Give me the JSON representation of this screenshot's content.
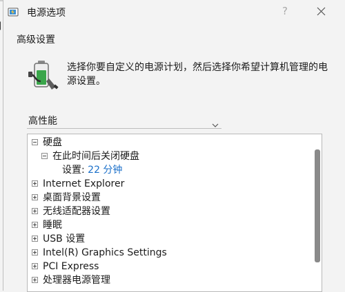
{
  "window": {
    "title": "电源选项",
    "help_label": "?"
  },
  "section_title": "高级设置",
  "description": "选择你要自定义的电源计划，然后选择你希望计算机管理的电源设置。",
  "plan": {
    "selected": "高性能"
  },
  "tree": {
    "hard_disk": "硬盘",
    "turn_off_after": "在此时间后关闭硬盘",
    "setting_prefix": "设置: ",
    "setting_value": "22 分钟",
    "internet_explorer": "Internet Explorer",
    "desktop_background": "桌面背景设置",
    "wireless_adapter": "无线适配器设置",
    "sleep": "睡眠",
    "usb": "USB 设置",
    "intel_graphics": "Intel(R) Graphics Settings",
    "pci_express": "PCI Express",
    "cpu_power": "处理器电源管理"
  },
  "colors": {
    "accent": "#1a6fc9",
    "battery_green": "#3aa64a"
  },
  "icons": {
    "title": "power-plan-icon",
    "battery": "battery-plug-icon"
  }
}
